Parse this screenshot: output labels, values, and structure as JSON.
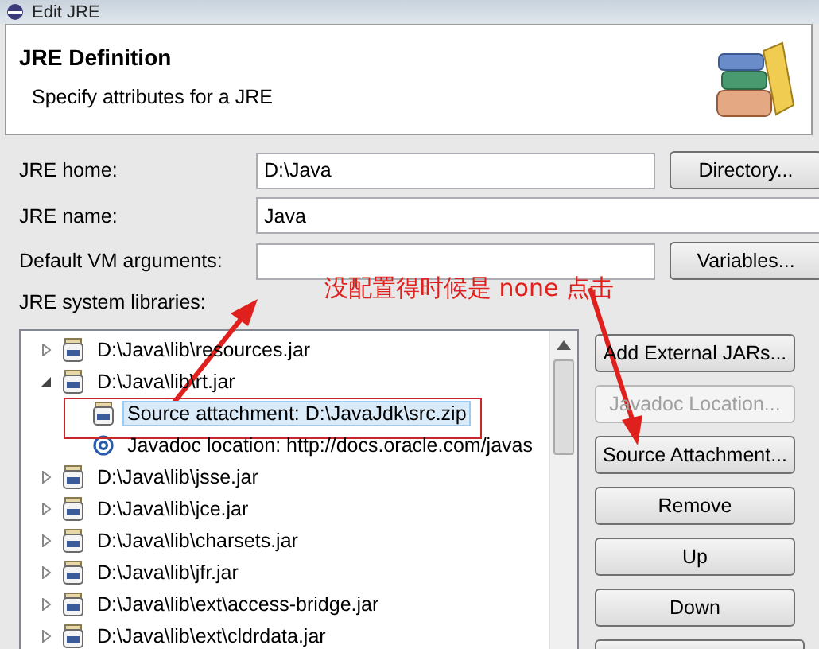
{
  "window": {
    "title": "Edit JRE"
  },
  "header": {
    "title": "JRE Definition",
    "subtitle": "Specify attributes for a JRE"
  },
  "fields": [
    {
      "label": "JRE home:",
      "value": "D:\\Java",
      "button": "Directory..."
    },
    {
      "label": "JRE name:",
      "value": "Java"
    },
    {
      "label": "Default VM arguments:",
      "button": "Variables..."
    }
  ],
  "libraries": {
    "label": "JRE system libraries:",
    "items": [
      {
        "kind": "jar",
        "text": "D:\\Java\\lib\\resources.jar",
        "expanded": false,
        "selected": false
      },
      {
        "kind": "jar",
        "text": "D:\\Java\\lib\\rt.jar",
        "expanded": true,
        "selected": false,
        "children": [
          {
            "kind": "source",
            "text": "Source attachment: D:\\JavaJdk\\src.zip",
            "selected": true
          },
          {
            "kind": "javadoc",
            "text": "Javadoc location: http://docs.oracle.com/javas",
            "selected": false
          }
        ]
      },
      {
        "kind": "jar",
        "text": "D:\\Java\\lib\\jsse.jar",
        "expanded": false,
        "selected": false
      },
      {
        "kind": "jar",
        "text": "D:\\Java\\lib\\jce.jar",
        "expanded": false,
        "selected": false
      },
      {
        "kind": "jar",
        "text": "D:\\Java\\lib\\charsets.jar",
        "expanded": false,
        "selected": false
      },
      {
        "kind": "jar",
        "text": "D:\\Java\\lib\\jfr.jar",
        "expanded": false,
        "selected": false
      },
      {
        "kind": "jar",
        "text": "D:\\Java\\lib\\ext\\access-bridge.jar",
        "expanded": false,
        "selected": false
      },
      {
        "kind": "jar",
        "text": "D:\\Java\\lib\\ext\\cldrdata.jar",
        "expanded": false,
        "selected": false
      }
    ]
  },
  "buttons": [
    {
      "label": "Add External JARs...",
      "disabled": false
    },
    {
      "label": "Javadoc Location...",
      "disabled": true
    },
    {
      "label": "Source Attachment...",
      "disabled": false
    },
    {
      "label": "Remove",
      "disabled": false
    },
    {
      "label": "Up",
      "disabled": false
    },
    {
      "label": "Down",
      "disabled": false
    }
  ],
  "annotation": {
    "text": "没配置得时候是 none 点击"
  }
}
